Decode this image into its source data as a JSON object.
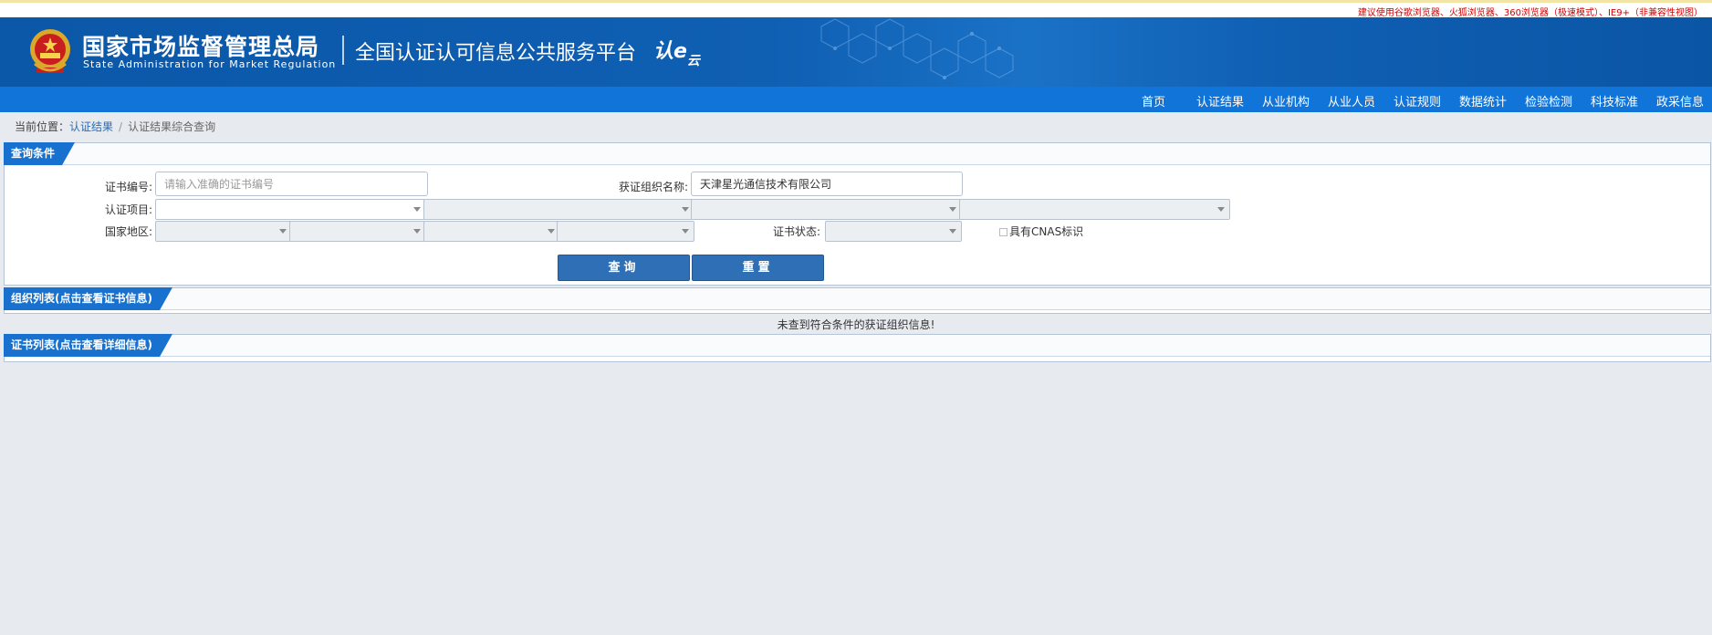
{
  "notice": "建议使用谷歌浏览器、火狐浏览器、360浏览器（极速模式）、IE9+（非兼容性视图）",
  "header": {
    "agency_name": "国家市场监督管理总局",
    "agency_name_en": "State Administration  for  Market Regulation",
    "platform_name": "全国认证认可信息公共服务平台",
    "brand_main": "认e",
    "brand_sub": "云"
  },
  "nav": {
    "items": [
      "首页",
      "认证结果",
      "从业机构",
      "从业人员",
      "认证规则",
      "数据统计",
      "检验检测",
      "科技标准",
      "政采信息"
    ]
  },
  "breadcrumb": {
    "prefix": "当前位置：",
    "link": "认证结果",
    "separator": "/",
    "current": "认证结果综合查询"
  },
  "query": {
    "title": "查询条件",
    "cert_no_label": "证书编号:",
    "cert_no_placeholder": "请输入准确的证书编号",
    "org_name_label": "获证组织名称:",
    "org_name_value": "天津星光通信技术有限公司",
    "project_label": "认证项目:",
    "region_label": "国家地区:",
    "status_label": "证书状态:",
    "cnas_label": "具有CNAS标识",
    "search_button": "查询",
    "reset_button": "重置"
  },
  "org_list": {
    "title": "组织列表(点击查看证书信息)",
    "empty_message": "未查到符合条件的获证组织信息!"
  },
  "cert_list": {
    "title": "证书列表(点击查看详细信息)"
  },
  "colors": {
    "banner_blue": "#0f5fb3",
    "nav_blue": "#1174d8",
    "tag_blue": "#1871cf",
    "button_blue": "#2e6fb6",
    "notice_red": "#d00000",
    "page_bg": "#e7eaee"
  }
}
